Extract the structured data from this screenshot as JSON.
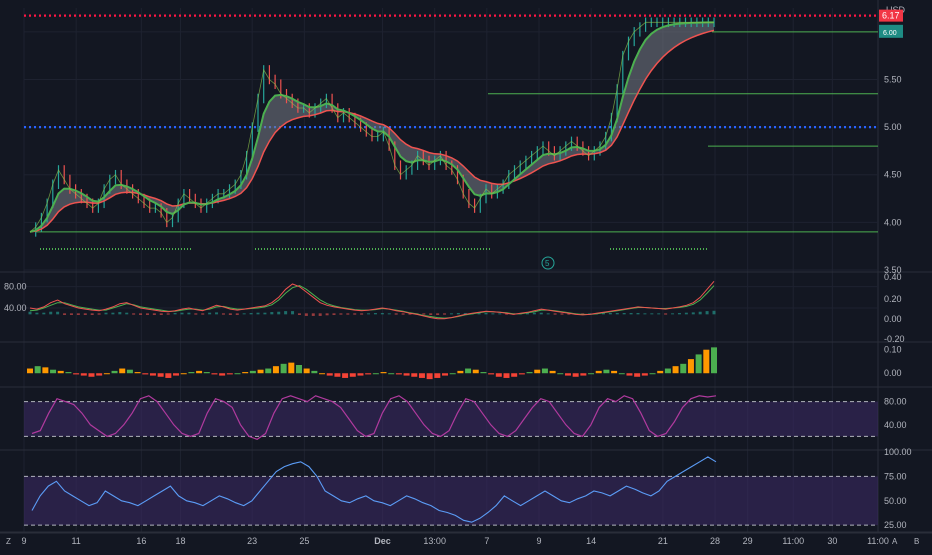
{
  "colors": {
    "background": "#131722",
    "grid": "#1e2230",
    "axis_text": "#b2b5be",
    "pane_border": "#2a2e39",
    "up": "#26a69a",
    "down": "#ef5350",
    "ema_fast": "#4caf50",
    "ema_slow": "#ef5350",
    "cloud": "#787b86",
    "green_line": "#4caf50",
    "blue_dotted": "#2962ff",
    "red_dotted": "#ff1744",
    "rsi": "#5b9cf6",
    "stoch": "#b03a9e",
    "band_fill": "#3d2a66",
    "teal_label": "#1e8c84"
  },
  "header": {
    "currency": "USD"
  },
  "price_labels": {
    "red_dotted_value": "6.17",
    "teal_value": "6.00"
  },
  "icons": {
    "session_marker": "5",
    "bottom_left": "Z",
    "bottom_right_a": "A",
    "bottom_right_b": "B"
  },
  "chart_data": [
    {
      "type": "line",
      "pane": "price",
      "ylim": [
        3.5,
        6.25
      ],
      "yticks": [
        "6.00",
        "5.50",
        "5.00",
        "4.50",
        "4.00",
        "3.50"
      ],
      "ytick_values": [
        6.0,
        5.5,
        5.0,
        4.5,
        4.0,
        3.5
      ],
      "x": [
        0,
        1,
        2,
        3,
        4,
        5,
        6,
        7,
        8,
        9,
        10,
        11,
        12,
        13,
        14,
        15,
        16,
        17,
        18,
        19,
        20,
        21,
        22,
        23,
        24,
        25,
        26,
        27,
        28,
        29,
        30,
        31,
        32,
        33,
        34,
        35,
        36,
        37,
        38,
        39,
        40,
        41,
        42,
        43,
        44,
        45,
        46,
        47,
        48,
        49,
        50,
        51,
        52,
        53,
        54,
        55,
        56,
        57,
        58,
        59,
        60,
        61,
        62,
        63,
        64,
        65,
        66,
        67,
        68,
        69,
        70,
        71,
        72,
        73,
        74,
        75,
        76,
        77,
        78,
        79,
        80,
        81,
        82,
        83,
        84,
        85,
        86,
        87,
        88,
        89,
        90,
        91,
        92,
        93,
        94,
        95,
        96,
        97,
        98,
        99,
        100,
        101,
        102,
        103,
        104,
        105,
        106,
        107,
        108,
        109,
        110,
        111,
        112,
        113,
        114,
        115,
        116,
        117,
        118,
        119,
        120
      ],
      "series": [
        {
          "values": [
            3.9,
            3.95,
            4.05,
            4.2,
            4.4,
            4.55,
            4.45,
            4.35,
            4.3,
            4.25,
            4.2,
            4.15,
            4.2,
            4.35,
            4.45,
            4.5,
            4.4,
            4.35,
            4.3,
            4.25,
            4.2,
            4.15,
            4.15,
            4.1,
            4.0,
            4.05,
            4.2,
            4.3,
            4.25,
            4.2,
            4.15,
            4.2,
            4.25,
            4.3,
            4.3,
            4.35,
            4.4,
            4.5,
            4.7,
            5.0,
            5.3,
            5.6,
            5.5,
            5.45,
            5.35,
            5.3,
            5.25,
            5.2,
            5.2,
            5.15,
            5.2,
            5.25,
            5.3,
            5.2,
            5.1,
            5.15,
            5.1,
            5.05,
            5.0,
            4.95,
            4.9,
            4.9,
            4.95,
            4.8,
            4.6,
            4.5,
            4.55,
            4.6,
            4.7,
            4.65,
            4.6,
            4.65,
            4.7,
            4.6,
            4.55,
            4.45,
            4.3,
            4.2,
            4.15,
            4.25,
            4.35,
            4.3,
            4.35,
            4.4,
            4.5,
            4.55,
            4.6,
            4.65,
            4.7,
            4.75,
            4.8,
            4.75,
            4.7,
            4.75,
            4.8,
            4.85,
            4.8,
            4.75,
            4.7,
            4.75,
            4.8,
            4.9,
            5.1,
            5.4,
            5.75,
            5.9,
            6.0,
            6.05,
            6.1,
            6.1,
            6.1,
            6.1,
            6.1,
            6.1,
            6.1,
            6.1,
            6.1,
            6.1,
            6.1,
            6.1,
            6.1
          ]
        }
      ],
      "reference_lines": [
        {
          "value": 6.17,
          "style": "dotted",
          "color": "red"
        },
        {
          "value": 6.0,
          "style": "solid",
          "color": "green"
        },
        {
          "value": 5.35,
          "style": "solid",
          "color": "green"
        },
        {
          "value": 5.0,
          "style": "dotted",
          "color": "blue"
        },
        {
          "value": 4.8,
          "style": "solid",
          "color": "green"
        },
        {
          "value": 3.9,
          "style": "solid",
          "color": "green"
        }
      ]
    },
    {
      "type": "line",
      "pane": "oscillator_1",
      "ylim": [
        -20,
        100
      ],
      "left_ticks": [
        "80.00",
        "40.00"
      ],
      "right_ticks": [
        "0.40",
        "0.20",
        "0.00",
        "-0.20"
      ],
      "series": [
        {
          "values": [
            40,
            38,
            42,
            50,
            55,
            48,
            44,
            40,
            38,
            36,
            35,
            38,
            42,
            48,
            50,
            45,
            40,
            38,
            36,
            34,
            33,
            35,
            38,
            40,
            37,
            35,
            40,
            45,
            42,
            38,
            36,
            38,
            40,
            42,
            44,
            50,
            60,
            75,
            85,
            80,
            70,
            60,
            50,
            45,
            42,
            40,
            38,
            36,
            35,
            36,
            38,
            40,
            38,
            35,
            33,
            30,
            28,
            25,
            22,
            20,
            20,
            22,
            25,
            28,
            30,
            32,
            34,
            33,
            32,
            30,
            28,
            30,
            32,
            35,
            38,
            36,
            34,
            32,
            30,
            28,
            27,
            28,
            30,
            32,
            34,
            36,
            38,
            40,
            42,
            41,
            40,
            39,
            38,
            40,
            42,
            45,
            50,
            60,
            75,
            90
          ]
        },
        {
          "values": [
            35,
            36,
            40,
            45,
            50,
            50,
            46,
            42,
            40,
            38,
            36,
            36,
            40,
            44,
            48,
            46,
            42,
            40,
            38,
            36,
            34,
            34,
            36,
            38,
            38,
            36,
            38,
            42,
            43,
            40,
            38,
            38,
            39,
            40,
            42,
            46,
            55,
            68,
            78,
            82,
            75,
            65,
            55,
            48,
            44,
            41,
            39,
            37,
            36,
            36,
            37,
            39,
            38,
            36,
            34,
            31,
            29,
            26,
            24,
            22,
            21,
            22,
            24,
            27,
            29,
            31,
            33,
            33,
            32,
            31,
            29,
            29,
            31,
            33,
            36,
            36,
            35,
            33,
            31,
            29,
            28,
            28,
            29,
            31,
            33,
            35,
            37,
            39,
            41,
            41,
            40,
            39,
            39,
            40,
            41,
            43,
            47,
            55,
            68,
            82
          ]
        }
      ]
    },
    {
      "type": "bar",
      "pane": "oscillator_2",
      "ylim": [
        -0.05,
        0.12
      ],
      "right_ticks": [
        "0.10",
        "0.00"
      ],
      "series": [
        {
          "values": [
            0.02,
            0.03,
            0.025,
            0.015,
            0.01,
            0.005,
            -0.005,
            -0.01,
            -0.015,
            -0.01,
            0.0,
            0.01,
            0.02,
            0.015,
            0.005,
            -0.005,
            -0.01,
            -0.015,
            -0.02,
            -0.01,
            0.0,
            0.005,
            0.01,
            0.005,
            -0.005,
            -0.01,
            -0.005,
            0.0,
            0.005,
            0.01,
            0.015,
            0.02,
            0.03,
            0.04,
            0.045,
            0.035,
            0.02,
            0.01,
            0.0,
            -0.01,
            -0.015,
            -0.02,
            -0.015,
            -0.01,
            -0.005,
            0.0,
            0.005,
            0.0,
            -0.005,
            -0.01,
            -0.015,
            -0.02,
            -0.025,
            -0.02,
            -0.01,
            0.0,
            0.01,
            0.02,
            0.015,
            0.005,
            -0.005,
            -0.015,
            -0.02,
            -0.015,
            -0.005,
            0.005,
            0.015,
            0.02,
            0.01,
            0.0,
            -0.01,
            -0.015,
            -0.01,
            0.0,
            0.01,
            0.015,
            0.01,
            0.0,
            -0.01,
            -0.015,
            -0.01,
            0.0,
            0.01,
            0.02,
            0.03,
            0.04,
            0.06,
            0.08,
            0.1,
            0.11
          ]
        }
      ]
    },
    {
      "type": "line",
      "pane": "stochastic",
      "ylim": [
        0,
        100
      ],
      "right_ticks": [
        "80.00",
        "40.00"
      ],
      "bands": [
        80,
        20
      ],
      "series": [
        {
          "values": [
            25,
            30,
            60,
            85,
            80,
            75,
            60,
            40,
            30,
            20,
            25,
            40,
            60,
            85,
            90,
            80,
            60,
            40,
            25,
            20,
            25,
            60,
            85,
            80,
            70,
            40,
            20,
            15,
            25,
            60,
            85,
            90,
            85,
            80,
            90,
            85,
            80,
            70,
            50,
            30,
            20,
            25,
            60,
            85,
            90,
            80,
            60,
            40,
            25,
            20,
            30,
            60,
            85,
            80,
            60,
            40,
            25,
            20,
            30,
            50,
            70,
            85,
            80,
            60,
            40,
            25,
            20,
            40,
            70,
            85,
            80,
            90,
            85,
            60,
            30,
            20,
            25,
            45,
            70,
            85,
            90,
            88,
            90
          ]
        }
      ]
    },
    {
      "type": "line",
      "pane": "rsi",
      "ylim": [
        20,
        100
      ],
      "right_ticks": [
        "100.00",
        "75.00",
        "50.00",
        "25.00"
      ],
      "bands": [
        75,
        25
      ],
      "series": [
        {
          "values": [
            40,
            55,
            65,
            70,
            60,
            55,
            50,
            45,
            48,
            60,
            55,
            50,
            48,
            45,
            50,
            55,
            60,
            65,
            55,
            50,
            48,
            45,
            50,
            55,
            52,
            48,
            45,
            50,
            60,
            70,
            80,
            85,
            88,
            90,
            85,
            75,
            60,
            55,
            50,
            48,
            52,
            55,
            50,
            48,
            45,
            50,
            55,
            52,
            48,
            45,
            40,
            38,
            35,
            30,
            28,
            32,
            38,
            45,
            55,
            50,
            45,
            50,
            55,
            60,
            55,
            50,
            48,
            52,
            55,
            60,
            58,
            55,
            60,
            65,
            62,
            58,
            55,
            60,
            70,
            75,
            80,
            85,
            90,
            95,
            90
          ]
        }
      ]
    }
  ],
  "x_axis": {
    "labels": [
      "9",
      "11",
      "16",
      "18",
      "23",
      "25",
      "Dec",
      "13:00",
      "7",
      "9",
      "14",
      "21",
      "28",
      "29",
      "11:00",
      "30",
      "11:00"
    ],
    "label_values": [
      0,
      8,
      18,
      24,
      35,
      43,
      55,
      63,
      71,
      79,
      87,
      98,
      106,
      111,
      118,
      124,
      131
    ]
  }
}
